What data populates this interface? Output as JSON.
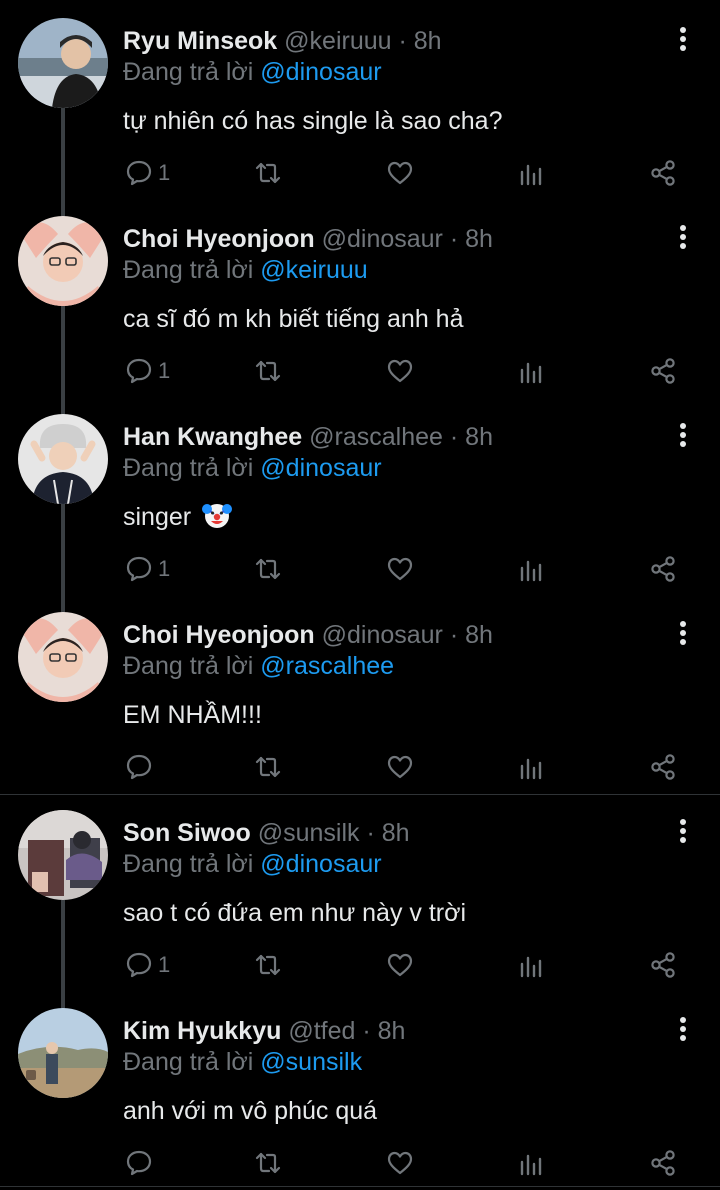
{
  "replying_label": "Đang trả lời",
  "tweets": [
    {
      "name": "Ryu Minseok",
      "handle": "@keiruuu",
      "time": "8h",
      "reply_to": "@dinosaur",
      "text": "tự nhiên có has single là sao cha?",
      "reply_count": "1"
    },
    {
      "name": "Choi Hyeonjoon",
      "handle": "@dinosaur",
      "time": "8h",
      "reply_to": "@keiruuu",
      "text": "ca sĩ đó m kh biết tiếng anh hả",
      "reply_count": "1"
    },
    {
      "name": "Han Kwanghee",
      "handle": "@rascalhee",
      "time": "8h",
      "reply_to": "@dinosaur",
      "text": "singer",
      "emoji": "clown-face",
      "reply_count": "1"
    },
    {
      "name": "Choi Hyeonjoon",
      "handle": "@dinosaur",
      "time": "8h",
      "reply_to": "@rascalhee",
      "text": "EM NHẦM!!!",
      "reply_count": ""
    },
    {
      "name": "Son Siwoo",
      "handle": "@sunsilk",
      "time": "8h",
      "reply_to": "@dinosaur",
      "text": "sao t có đứa em như này v trời",
      "reply_count": "1"
    },
    {
      "name": "Kim Hyukkyu",
      "handle": "@tfed",
      "time": "8h",
      "reply_to": "@sunsilk",
      "text": "anh với m vô phúc quá",
      "reply_count": ""
    }
  ],
  "colors": {
    "background": "#000000",
    "text": "#e7e9ea",
    "muted": "#71767b",
    "mention": "#1d9bf0",
    "thread_line": "#3a3f43"
  },
  "icons": [
    "reply-icon",
    "retweet-icon",
    "like-icon",
    "views-icon",
    "share-icon",
    "more-icon"
  ]
}
